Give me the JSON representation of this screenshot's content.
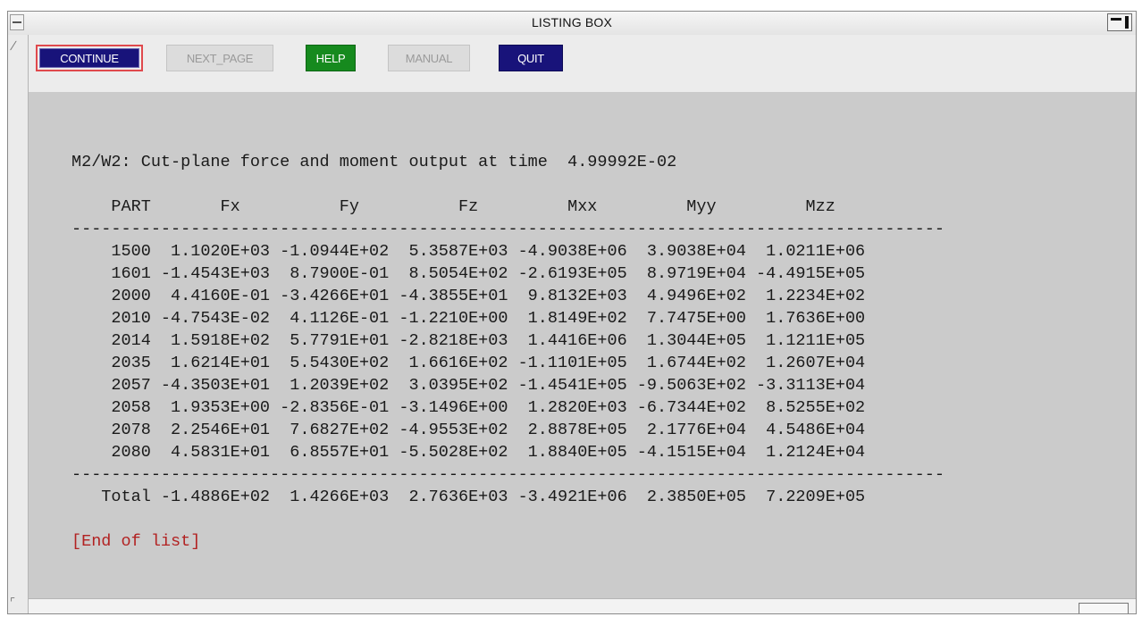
{
  "window": {
    "title": "LISTING BOX"
  },
  "toolbar": {
    "continue_label": "CONTINUE",
    "next_page_label": "NEXT_PAGE",
    "help_label": "HELP",
    "manual_label": "MANUAL",
    "quit_label": "QUIT"
  },
  "listing": {
    "heading": "M2/W2: Cut-plane force and moment output at time  4.99992E-02",
    "columns": [
      "PART",
      "Fx",
      "Fy",
      "Fz",
      "Mxx",
      "Myy",
      "Mzz"
    ],
    "rows": [
      [
        "1500",
        "1.1020E+03",
        "-1.0944E+02",
        "5.3587E+03",
        "-4.9038E+06",
        "3.9038E+04",
        "1.0211E+06"
      ],
      [
        "1601",
        "-1.4543E+03",
        "8.7900E-01",
        "8.5054E+02",
        "-2.6193E+05",
        "8.9719E+04",
        "-4.4915E+05"
      ],
      [
        "2000",
        "4.4160E-01",
        "-3.4266E+01",
        "-4.3855E+01",
        "9.8132E+03",
        "4.9496E+02",
        "1.2234E+02"
      ],
      [
        "2010",
        "-4.7543E-02",
        "4.1126E-01",
        "-1.2210E+00",
        "1.8149E+02",
        "7.7475E+00",
        "1.7636E+00"
      ],
      [
        "2014",
        "1.5918E+02",
        "5.7791E+01",
        "-2.8218E+03",
        "1.4416E+06",
        "1.3044E+05",
        "1.1211E+05"
      ],
      [
        "2035",
        "1.6214E+01",
        "5.5430E+02",
        "1.6616E+02",
        "-1.1101E+05",
        "1.6744E+02",
        "1.2607E+04"
      ],
      [
        "2057",
        "-4.3503E+01",
        "1.2039E+02",
        "3.0395E+02",
        "-1.4541E+05",
        "-9.5063E+02",
        "-3.3113E+04"
      ],
      [
        "2058",
        "1.9353E+00",
        "-2.8356E-01",
        "-3.1496E+00",
        "1.2820E+03",
        "-6.7344E+02",
        "8.5255E+02"
      ],
      [
        "2078",
        "2.2546E+01",
        "7.6827E+02",
        "-4.9553E+02",
        "2.8878E+05",
        "2.1776E+04",
        "4.5486E+04"
      ],
      [
        "2080",
        "4.5831E+01",
        "6.8557E+01",
        "-5.5028E+02",
        "1.8840E+05",
        "-4.1515E+04",
        "1.2124E+04"
      ]
    ],
    "total": [
      "Total",
      "-1.4886E+02",
      "1.4266E+03",
      "2.7636E+03",
      "-3.4921E+06",
      "2.3850E+05",
      "7.2209E+05"
    ],
    "end_text": "[End of list]"
  }
}
